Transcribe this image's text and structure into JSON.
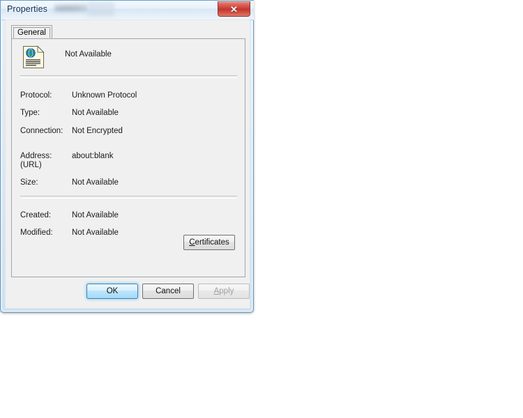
{
  "window": {
    "title": "Properties",
    "title_redacted_hint": "",
    "close_icon_label": "✕"
  },
  "tabs": [
    {
      "label": "General",
      "selected": true
    }
  ],
  "general": {
    "document_icon": "html-document-icon",
    "document_name": "Not Available",
    "rows": [
      {
        "label": "Protocol:",
        "value": "Unknown Protocol"
      },
      {
        "label": "Type:",
        "value": "Not Available"
      },
      {
        "label": "Connection:",
        "value": "Not Encrypted"
      },
      {
        "label": "Address:\n(URL)",
        "value": "about:blank"
      },
      {
        "label": "Size:",
        "value": "Not Available"
      },
      {
        "label": "Created:",
        "value": "Not Available"
      },
      {
        "label": "Modified:",
        "value": "Not Available"
      }
    ],
    "certificates_button": "Certificates",
    "certificates_accel": "C"
  },
  "footer": {
    "ok_label": "OK",
    "cancel_label": "Cancel",
    "apply_label": "Apply",
    "apply_accel": "A",
    "apply_enabled": false
  },
  "colors": {
    "titlebar_start": "#f4f9fd",
    "titlebar_end": "#eef5fb",
    "window_border": "#6b9ec4",
    "close_button": "#c0372f",
    "dialog_face": "#f0f0f0",
    "default_button_accent": "#3c7fb1",
    "text": "#1a1a1a",
    "disabled_text": "#a0a0a0"
  }
}
